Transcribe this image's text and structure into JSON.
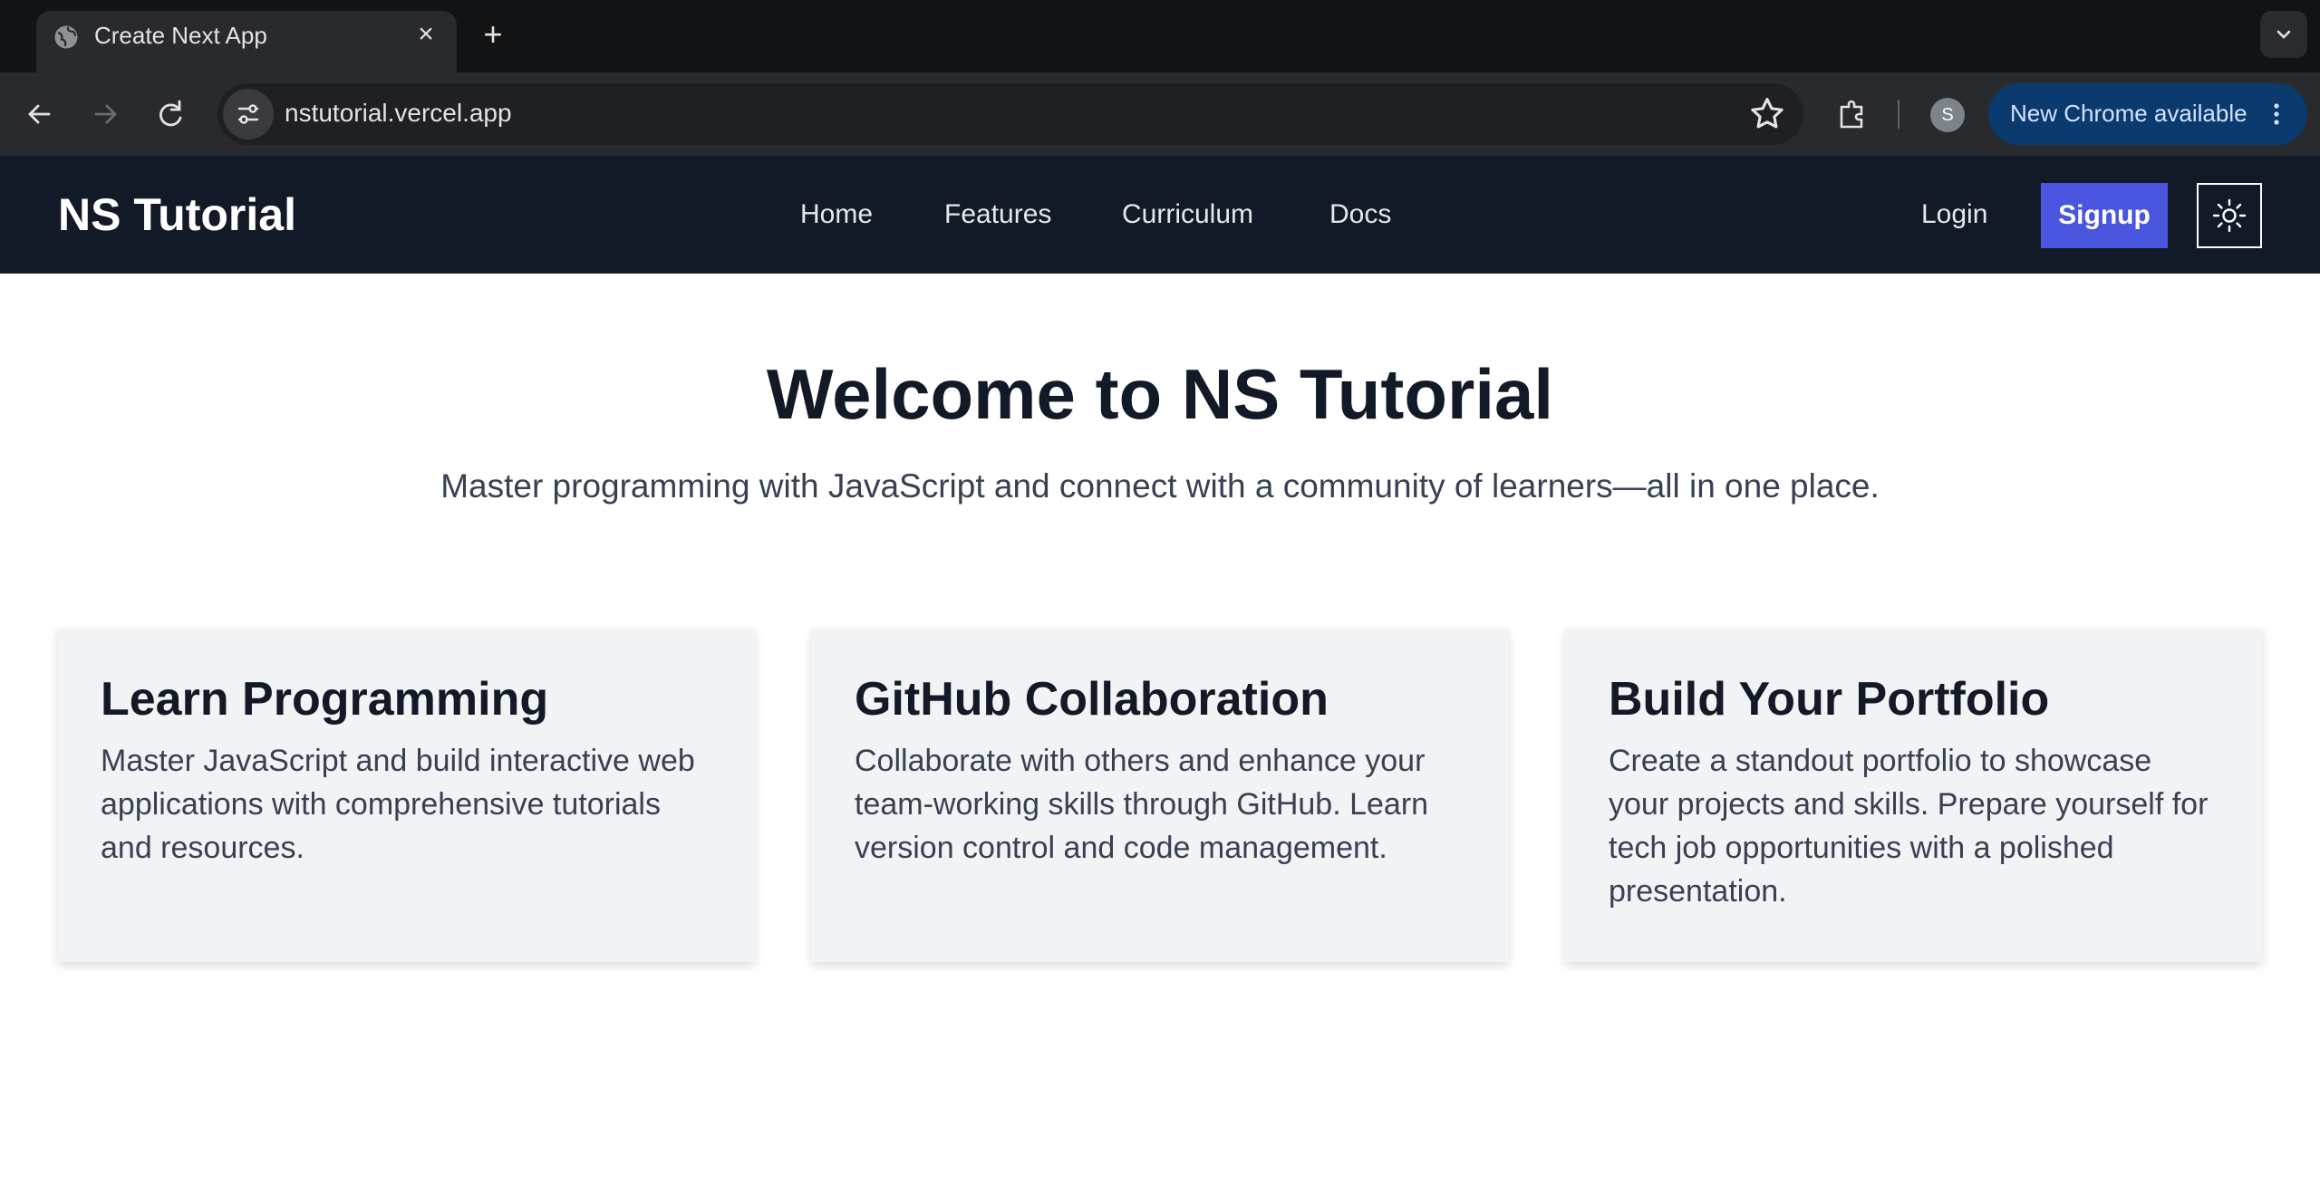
{
  "browser": {
    "tab_title": "Create Next App",
    "url": "nstutorial.vercel.app",
    "profile_initial": "S",
    "update_label": "New Chrome available",
    "accent": "#0b3a6e"
  },
  "header": {
    "brand": "NS Tutorial",
    "nav": [
      "Home",
      "Features",
      "Curriculum",
      "Docs"
    ],
    "login": "Login",
    "signup": "Signup",
    "background": "#131a27",
    "signup_color": "#4a55e0"
  },
  "hero": {
    "title": "Welcome to NS Tutorial",
    "subtitle": "Master programming with JavaScript and connect with a community of learners—all in one place."
  },
  "cards": [
    {
      "title": "Learn Programming",
      "text": "Master JavaScript and build interactive web applications with comprehensive tutorials and resources."
    },
    {
      "title": "GitHub Collaboration",
      "text": "Collaborate with others and enhance your team-working skills through GitHub. Learn version control and code management."
    },
    {
      "title": "Build Your Portfolio",
      "text": "Create a standout portfolio to showcase your projects and skills. Prepare yourself for tech job opportunities with a polished presentation."
    }
  ]
}
